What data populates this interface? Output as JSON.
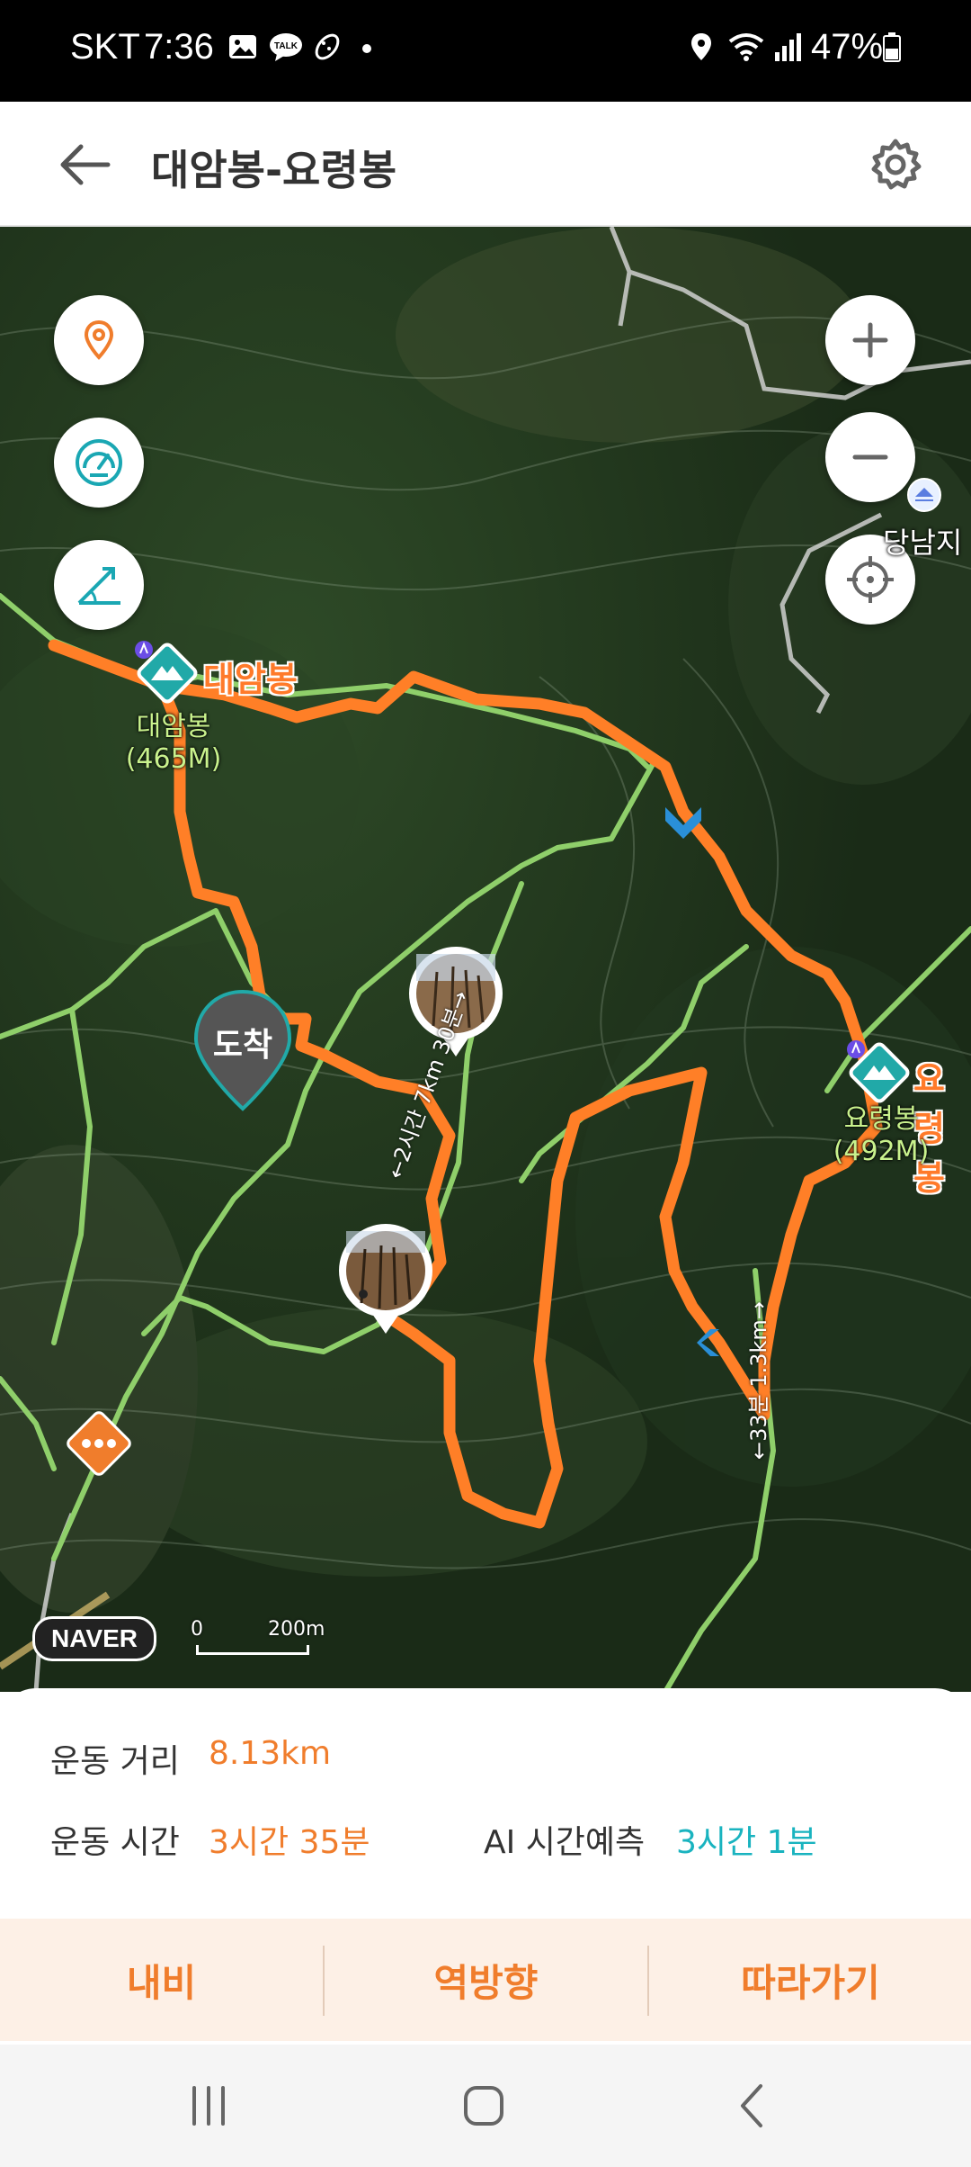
{
  "status_bar": {
    "carrier": "SKT",
    "time": "7:36",
    "notification_icons": [
      "gallery-icon",
      "talk-icon",
      "shoe-icon",
      "dot-icon"
    ],
    "system_icons": [
      "location-icon",
      "wifi-icon",
      "signal-icon",
      "battery-icon"
    ],
    "battery": "47%"
  },
  "header": {
    "title": "대암봉-요령봉",
    "back_icon": "arrow-left-icon",
    "settings_icon": "gear-icon"
  },
  "map": {
    "left_controls": [
      "location-pin-icon",
      "speedometer-icon",
      "slope-icon"
    ],
    "right_controls": [
      "zoom-in-icon",
      "zoom-out-icon",
      "crosshair-icon"
    ],
    "peaks": [
      {
        "name": "대암봉",
        "label": "대암봉",
        "elevation": "(465M)"
      },
      {
        "name": "요령봉",
        "label": "요령봉",
        "elevation": "(492M)"
      }
    ],
    "place_label": "당남지",
    "arrival_marker": "도착",
    "path_label_1": "←2시간 7km 30분→",
    "path_label_2": "←33분 1.3km→",
    "provider": "NAVER",
    "scale": {
      "zero": "0",
      "distance": "200m"
    },
    "colors": {
      "route": "#ff7f27",
      "trail": "#8fcf6a",
      "marker": "#21a9a8"
    }
  },
  "stats": {
    "distance_label": "운동 거리",
    "distance_value": "8.13km",
    "time_label": "운동 시간",
    "time_value": "3시간 35분",
    "ai_label": "AI 시간예측",
    "ai_value": "3시간 1분"
  },
  "actions": {
    "navigate": "내비",
    "reverse": "역방향",
    "follow": "따라가기"
  },
  "nav_bar": [
    "recents-icon",
    "home-icon",
    "back-icon"
  ]
}
